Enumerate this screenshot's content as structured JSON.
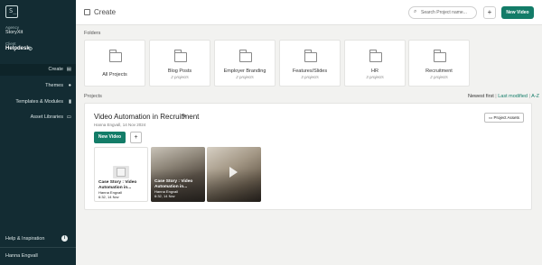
{
  "sidebar": {
    "logo": "S_",
    "agency_label": "Agency",
    "agency_name": "StoryXit",
    "client_label": "Client",
    "client_name": "Helpdesk",
    "client_icon": "gear-icon",
    "nav": [
      {
        "label": "Create",
        "icon": "layout-icon",
        "active": true
      },
      {
        "label": "Themes",
        "icon": "palette-icon",
        "active": false
      },
      {
        "label": "Templates & Modules",
        "icon": "bookmark-icon",
        "active": false
      },
      {
        "label": "Asset Libraries",
        "icon": "library-icon",
        "active": false
      }
    ],
    "help_label": "Help & Inspiration",
    "help_icon": "info-icon",
    "user_name": "Hanna Engvall"
  },
  "topbar": {
    "title": "Create",
    "search_placeholder": "Search Project name...",
    "plus_label": "+",
    "new_video_label": "New Video"
  },
  "folders_label": "Folders",
  "folders": [
    {
      "name": "All Projects",
      "count": ""
    },
    {
      "name": "Blog Posts",
      "count": "2 projects"
    },
    {
      "name": "Employer Branding",
      "count": "2 projects"
    },
    {
      "name": "Features/Slides",
      "count": "3 projects"
    },
    {
      "name": "HR",
      "count": "3 projects"
    },
    {
      "name": "Recruitment",
      "count": "2 projects"
    }
  ],
  "projects_label": "Projects",
  "sort": {
    "label": "Newest first",
    "sep": "|",
    "option1": "Last modified",
    "option2": "A-Z"
  },
  "project": {
    "title": "Video Automation in Recruitment",
    "meta": "Hanna Engvall, 14 Nov 2024",
    "assets_label": "Project Assets",
    "new_video_label": "New Video",
    "plus_label": "+",
    "videos": [
      {
        "title": "Case Story : Video Automation in...",
        "author": "Hanna Engvall",
        "time": "6:32, 14 Nov"
      },
      {
        "title": "Case Story : Video Automation in...",
        "author": "Hanna Engvall",
        "time": "6:32, 14 Nov"
      },
      {
        "title": "",
        "author": "",
        "time": ""
      }
    ]
  },
  "colors": {
    "brand": "#137c68",
    "sidebar": "#132c33"
  }
}
